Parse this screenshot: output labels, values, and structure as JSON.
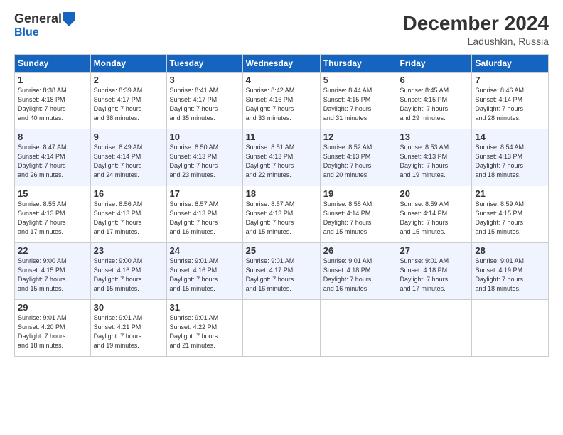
{
  "header": {
    "logo": {
      "general": "General",
      "blue": "Blue"
    },
    "title": "December 2024",
    "subtitle": "Ladushkin, Russia"
  },
  "weekdays": [
    "Sunday",
    "Monday",
    "Tuesday",
    "Wednesday",
    "Thursday",
    "Friday",
    "Saturday"
  ],
  "weeks": [
    [
      {
        "day": "1",
        "sunrise": "8:38 AM",
        "sunset": "4:18 PM",
        "daylight": "7 hours and 40 minutes."
      },
      {
        "day": "2",
        "sunrise": "8:39 AM",
        "sunset": "4:17 PM",
        "daylight": "7 hours and 38 minutes."
      },
      {
        "day": "3",
        "sunrise": "8:41 AM",
        "sunset": "4:17 PM",
        "daylight": "7 hours and 35 minutes."
      },
      {
        "day": "4",
        "sunrise": "8:42 AM",
        "sunset": "4:16 PM",
        "daylight": "7 hours and 33 minutes."
      },
      {
        "day": "5",
        "sunrise": "8:44 AM",
        "sunset": "4:15 PM",
        "daylight": "7 hours and 31 minutes."
      },
      {
        "day": "6",
        "sunrise": "8:45 AM",
        "sunset": "4:15 PM",
        "daylight": "7 hours and 29 minutes."
      },
      {
        "day": "7",
        "sunrise": "8:46 AM",
        "sunset": "4:14 PM",
        "daylight": "7 hours and 28 minutes."
      }
    ],
    [
      {
        "day": "8",
        "sunrise": "8:47 AM",
        "sunset": "4:14 PM",
        "daylight": "7 hours and 26 minutes."
      },
      {
        "day": "9",
        "sunrise": "8:49 AM",
        "sunset": "4:14 PM",
        "daylight": "7 hours and 24 minutes."
      },
      {
        "day": "10",
        "sunrise": "8:50 AM",
        "sunset": "4:13 PM",
        "daylight": "7 hours and 23 minutes."
      },
      {
        "day": "11",
        "sunrise": "8:51 AM",
        "sunset": "4:13 PM",
        "daylight": "7 hours and 22 minutes."
      },
      {
        "day": "12",
        "sunrise": "8:52 AM",
        "sunset": "4:13 PM",
        "daylight": "7 hours and 20 minutes."
      },
      {
        "day": "13",
        "sunrise": "8:53 AM",
        "sunset": "4:13 PM",
        "daylight": "7 hours and 19 minutes."
      },
      {
        "day": "14",
        "sunrise": "8:54 AM",
        "sunset": "4:13 PM",
        "daylight": "7 hours and 18 minutes."
      }
    ],
    [
      {
        "day": "15",
        "sunrise": "8:55 AM",
        "sunset": "4:13 PM",
        "daylight": "7 hours and 17 minutes."
      },
      {
        "day": "16",
        "sunrise": "8:56 AM",
        "sunset": "4:13 PM",
        "daylight": "7 hours and 17 minutes."
      },
      {
        "day": "17",
        "sunrise": "8:57 AM",
        "sunset": "4:13 PM",
        "daylight": "7 hours and 16 minutes."
      },
      {
        "day": "18",
        "sunrise": "8:57 AM",
        "sunset": "4:13 PM",
        "daylight": "7 hours and 15 minutes."
      },
      {
        "day": "19",
        "sunrise": "8:58 AM",
        "sunset": "4:14 PM",
        "daylight": "7 hours and 15 minutes."
      },
      {
        "day": "20",
        "sunrise": "8:59 AM",
        "sunset": "4:14 PM",
        "daylight": "7 hours and 15 minutes."
      },
      {
        "day": "21",
        "sunrise": "8:59 AM",
        "sunset": "4:15 PM",
        "daylight": "7 hours and 15 minutes."
      }
    ],
    [
      {
        "day": "22",
        "sunrise": "9:00 AM",
        "sunset": "4:15 PM",
        "daylight": "7 hours and 15 minutes."
      },
      {
        "day": "23",
        "sunrise": "9:00 AM",
        "sunset": "4:16 PM",
        "daylight": "7 hours and 15 minutes."
      },
      {
        "day": "24",
        "sunrise": "9:01 AM",
        "sunset": "4:16 PM",
        "daylight": "7 hours and 15 minutes."
      },
      {
        "day": "25",
        "sunrise": "9:01 AM",
        "sunset": "4:17 PM",
        "daylight": "7 hours and 16 minutes."
      },
      {
        "day": "26",
        "sunrise": "9:01 AM",
        "sunset": "4:18 PM",
        "daylight": "7 hours and 16 minutes."
      },
      {
        "day": "27",
        "sunrise": "9:01 AM",
        "sunset": "4:18 PM",
        "daylight": "7 hours and 17 minutes."
      },
      {
        "day": "28",
        "sunrise": "9:01 AM",
        "sunset": "4:19 PM",
        "daylight": "7 hours and 18 minutes."
      }
    ],
    [
      {
        "day": "29",
        "sunrise": "9:01 AM",
        "sunset": "4:20 PM",
        "daylight": "7 hours and 18 minutes."
      },
      {
        "day": "30",
        "sunrise": "9:01 AM",
        "sunset": "4:21 PM",
        "daylight": "7 hours and 19 minutes."
      },
      {
        "day": "31",
        "sunrise": "9:01 AM",
        "sunset": "4:22 PM",
        "daylight": "7 hours and 21 minutes."
      },
      null,
      null,
      null,
      null
    ]
  ],
  "labels": {
    "sunrise": "Sunrise:",
    "sunset": "Sunset:",
    "daylight": "Daylight:"
  }
}
